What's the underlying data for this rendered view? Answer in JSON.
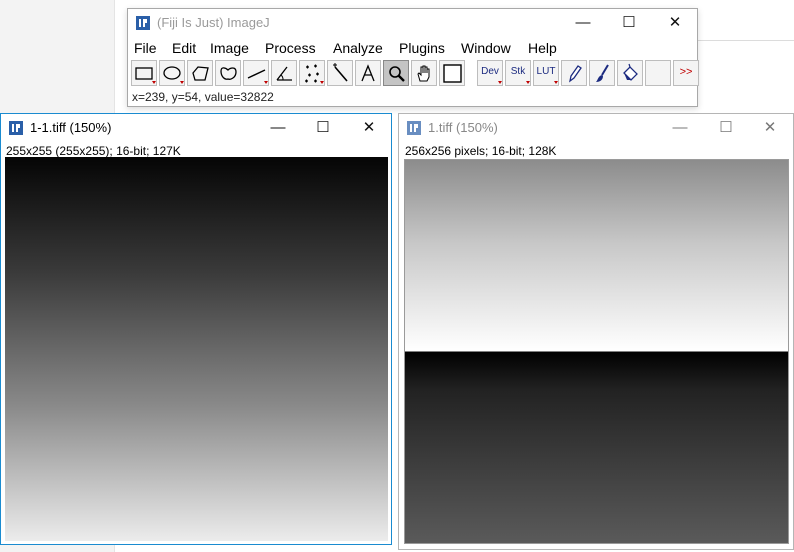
{
  "ij": {
    "title": "(Fiji Is Just) ImageJ",
    "menus": [
      "File",
      "Edit",
      "Image",
      "Process",
      "Analyze",
      "Plugins",
      "Window",
      "Help"
    ],
    "tools": [
      {
        "name": "rectangle-tool-icon"
      },
      {
        "name": "oval-tool-icon"
      },
      {
        "name": "polygon-tool-icon"
      },
      {
        "name": "freehand-tool-icon"
      },
      {
        "name": "line-tool-icon"
      },
      {
        "name": "angle-tool-icon"
      },
      {
        "name": "multipoint-tool-icon"
      },
      {
        "name": "wand-tool-icon"
      },
      {
        "name": "text-tool-icon"
      },
      {
        "name": "magnifier-tool-icon",
        "selected": true
      },
      {
        "name": "hand-tool-icon"
      },
      {
        "name": "color-picker-tool-icon"
      },
      {
        "label": "Dev",
        "name": "dev-menu-tool"
      },
      {
        "label": "Stk",
        "name": "stack-menu-tool"
      },
      {
        "label": "LUT",
        "name": "lut-menu-tool"
      },
      {
        "name": "pencil-tool-icon"
      },
      {
        "name": "brush-tool-icon"
      },
      {
        "name": "flood-fill-tool-icon"
      },
      {
        "name": "empty-tool-slot"
      },
      {
        "label": ">>",
        "name": "more-tools-button"
      }
    ],
    "status": "x=239, y=54, value=32822"
  },
  "win1": {
    "title": "1-1.tiff (150%)",
    "info": "255x255   (255x255); 16-bit; 127K"
  },
  "win2": {
    "title": "1.tiff (150%)",
    "info": "256x256 pixels; 16-bit; 128K"
  },
  "window_controls": {
    "minimize": "—",
    "maximize": "☐",
    "close": "✕"
  },
  "colors": {
    "accent_border": "#1a8bd0",
    "icon_blue": "#2a5fa8",
    "tool_text": "#1c2b80",
    "dropdown_red": "#c00000"
  }
}
